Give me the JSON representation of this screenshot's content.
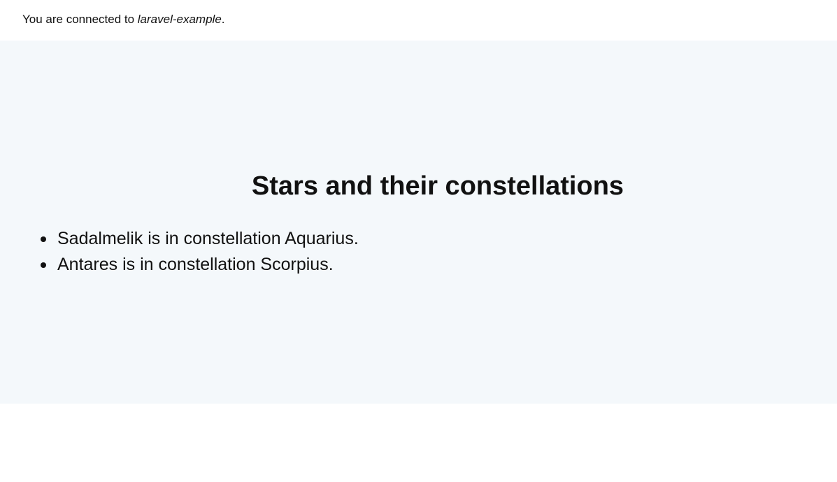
{
  "topbar": {
    "prefix": "You are connected to ",
    "database": "laravel-example",
    "suffix": "."
  },
  "main": {
    "title": "Stars and their constellations",
    "items": [
      "Sadalmelik is in constellation Aquarius.",
      "Antares is in constellation Scorpius."
    ]
  }
}
